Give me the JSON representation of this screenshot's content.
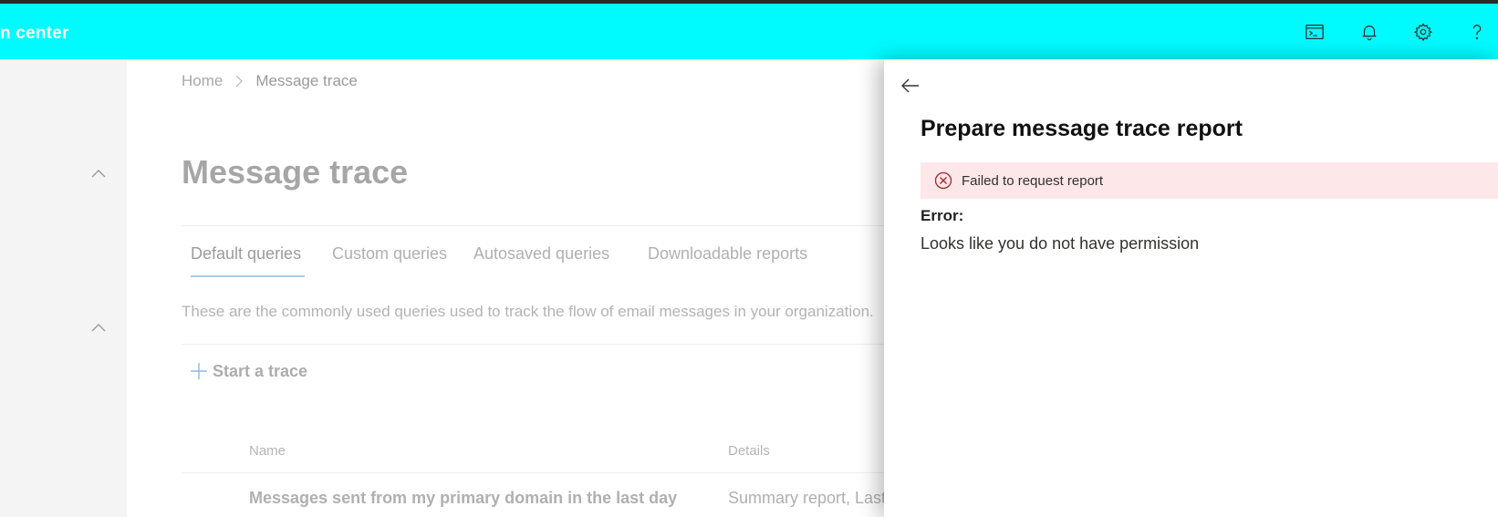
{
  "header": {
    "app_title": "n center",
    "icons": [
      "terminal-icon",
      "bell-icon",
      "gear-icon",
      "help-icon"
    ],
    "background_color": "#00fbff"
  },
  "breadcrumb": {
    "home": "Home",
    "current": "Message trace"
  },
  "page": {
    "title": "Message trace",
    "tabs": [
      {
        "label": "Default queries",
        "active": true
      },
      {
        "label": "Custom queries",
        "active": false
      },
      {
        "label": "Autosaved queries",
        "active": false
      },
      {
        "label": "Downloadable reports",
        "active": false
      }
    ],
    "description": "These are the commonly used queries used to track the flow of email messages in your organization.",
    "start_trace_label": "Start a trace",
    "table": {
      "columns": [
        "Name",
        "Details"
      ],
      "rows": [
        {
          "name": "Messages sent from my primary domain in the last day",
          "details": "Summary report, Last"
        }
      ]
    }
  },
  "panel": {
    "title": "Prepare message trace report",
    "error_bar": {
      "text": "Failed to request report",
      "background_color": "#fde7e9",
      "icon_color": "#a4262c"
    },
    "error_label": "Error:",
    "error_message": "Looks like you do not have permission"
  }
}
